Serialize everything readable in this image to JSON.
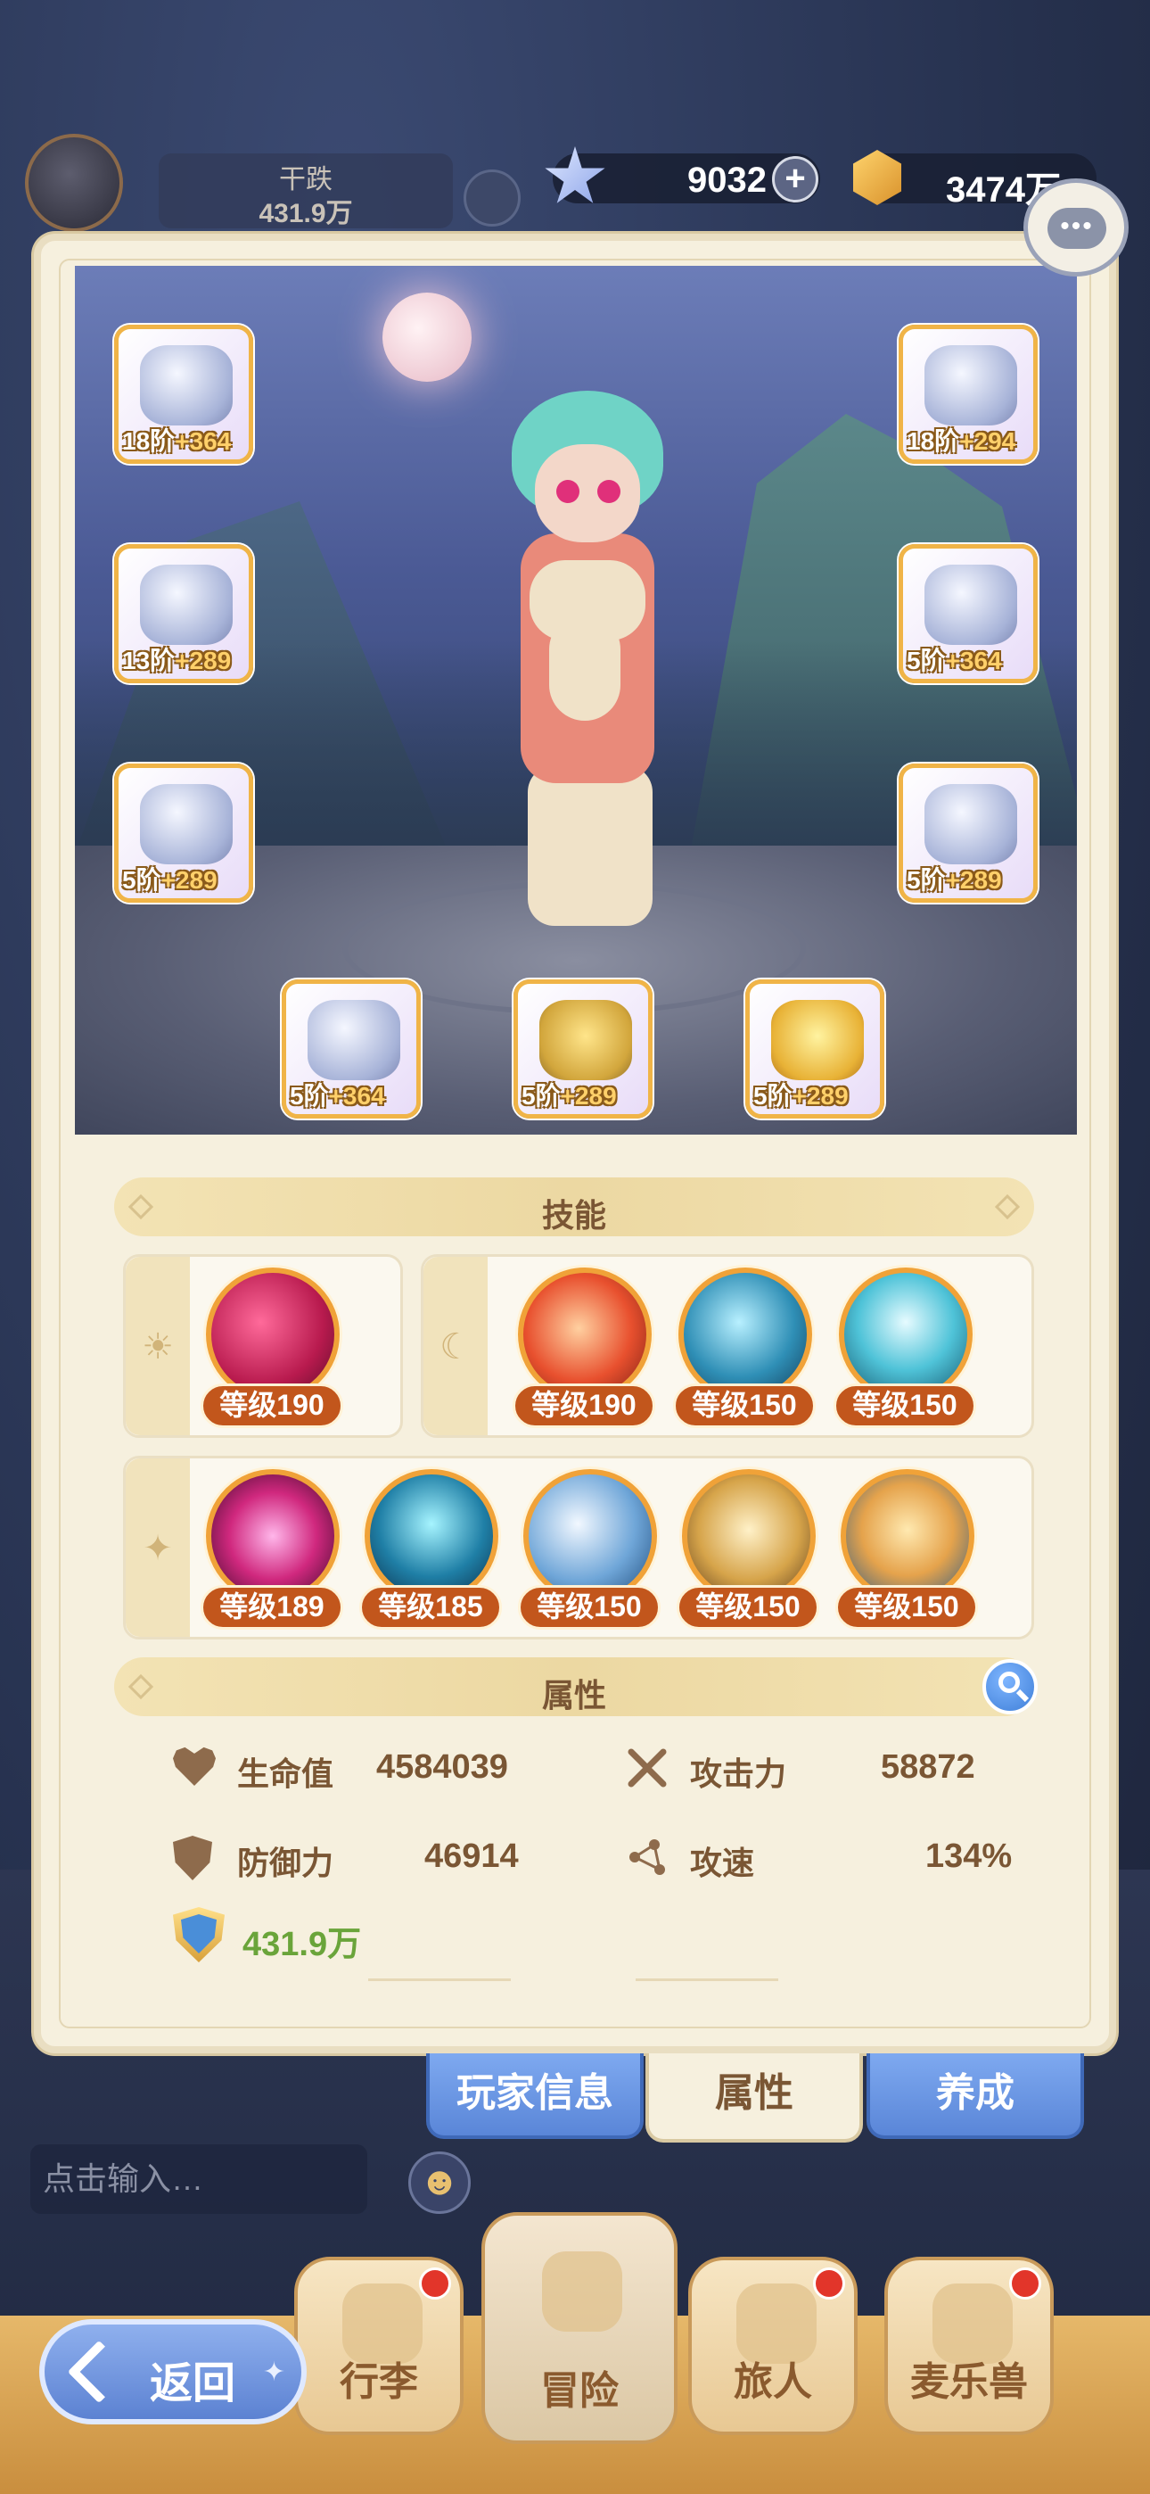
{
  "player": {
    "name": "干跌",
    "power": "431.9万"
  },
  "currency": {
    "gems": "9032",
    "plus_label": "+",
    "gold": "3474万"
  },
  "equipment": [
    {
      "id": "weapon",
      "stage": "18阶",
      "plus": "+364",
      "art": "purple"
    },
    {
      "id": "helmet",
      "stage": "18阶",
      "plus": "+294",
      "art": "purple"
    },
    {
      "id": "armor",
      "stage": "13阶",
      "plus": "+289",
      "art": "purple"
    },
    {
      "id": "gloves",
      "stage": "5阶",
      "plus": "+364",
      "art": "purple"
    },
    {
      "id": "cloak",
      "stage": "5阶",
      "plus": "+289",
      "art": "purple"
    },
    {
      "id": "boots",
      "stage": "5阶",
      "plus": "+289",
      "art": "purple"
    },
    {
      "id": "ring",
      "stage": "5阶",
      "plus": "+364",
      "art": "purple"
    },
    {
      "id": "necklace",
      "stage": "5阶",
      "plus": "+289",
      "art": "amber"
    },
    {
      "id": "charm",
      "stage": "5阶",
      "plus": "+289",
      "art": "gold"
    }
  ],
  "skills_section": {
    "title": "技能",
    "active_group": {
      "icon": "☀",
      "skills": [
        {
          "level": "等级190",
          "color": "red"
        }
      ]
    },
    "passive_group": {
      "icon": "☾",
      "skills": [
        {
          "level": "等级190",
          "color": "fire"
        },
        {
          "level": "等级150",
          "color": "blue"
        },
        {
          "level": "等级150",
          "color": "cyan"
        }
      ]
    },
    "talent_group": {
      "icon": "✦",
      "skills": [
        {
          "level": "等级189",
          "color": "pink"
        },
        {
          "level": "等级185",
          "color": "teal"
        },
        {
          "level": "等级150",
          "color": "sky"
        },
        {
          "level": "等级150",
          "color": "gold"
        },
        {
          "level": "等级150",
          "color": "wolf"
        }
      ]
    }
  },
  "attributes_section": {
    "title": "属性",
    "hp": {
      "label": "生命值",
      "value": "4584039"
    },
    "attack": {
      "label": "攻击力",
      "value": "58872"
    },
    "defense": {
      "label": "防御力",
      "value": "46914"
    },
    "attack_speed": {
      "label": "攻速",
      "value": "134%"
    },
    "combat_power": "431.9万"
  },
  "tabs": {
    "player_info": "玩家信息",
    "attributes": "属性",
    "develop": "养成"
  },
  "chat": {
    "placeholder": "点击输入…",
    "emoji": "☻"
  },
  "nav": {
    "luggage": "行李",
    "adventure": "冒险",
    "traveler": "旅人",
    "pet": "麦乐兽"
  },
  "back": {
    "label": "返回",
    "star": "✦"
  },
  "colors": {
    "accent_orange": "#f0a238",
    "level_badge": "#c2561c",
    "tab_blue": "#5a86d8",
    "power_green": "#6aa43a"
  }
}
